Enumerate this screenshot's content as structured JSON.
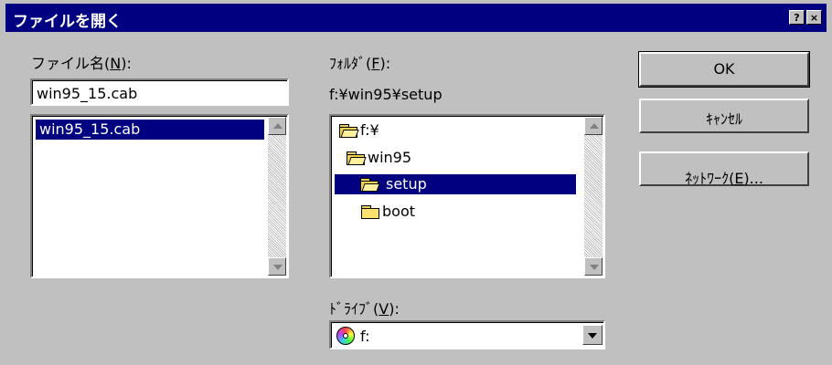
{
  "window": {
    "title": "ファイルを開く",
    "help_button": "?",
    "close_button": "×"
  },
  "filename": {
    "label_pre": "ファイル名(",
    "label_key": "N",
    "label_post": "):",
    "value": "win95_15.cab",
    "list": [
      "win95_15.cab"
    ]
  },
  "folder": {
    "label_pre": "ﾌｫﾙﾀﾞ(",
    "label_key": "F",
    "label_post": "):",
    "current_path": "f:¥win95¥setup",
    "tree": [
      {
        "label": "f:¥",
        "type": "open",
        "selected": false
      },
      {
        "label": "win95",
        "type": "open",
        "selected": false
      },
      {
        "label": "setup",
        "type": "open",
        "selected": true
      },
      {
        "label": "boot",
        "type": "closed",
        "selected": false
      }
    ]
  },
  "drive": {
    "label_pre": "ﾄﾞﾗｲﾌﾞ(",
    "label_key": "V",
    "label_post": "):",
    "value": "f:",
    "icon": "cd-drive-icon"
  },
  "buttons": {
    "ok": "OK",
    "cancel": "ｷｬﾝｾﾙ",
    "network_pre": "ﾈｯﾄﾜｰｸ(",
    "network_key": "E",
    "network_post": ")..."
  },
  "colors": {
    "titlebar": "#000080",
    "face": "#c0c0c0",
    "selection": "#000080"
  }
}
